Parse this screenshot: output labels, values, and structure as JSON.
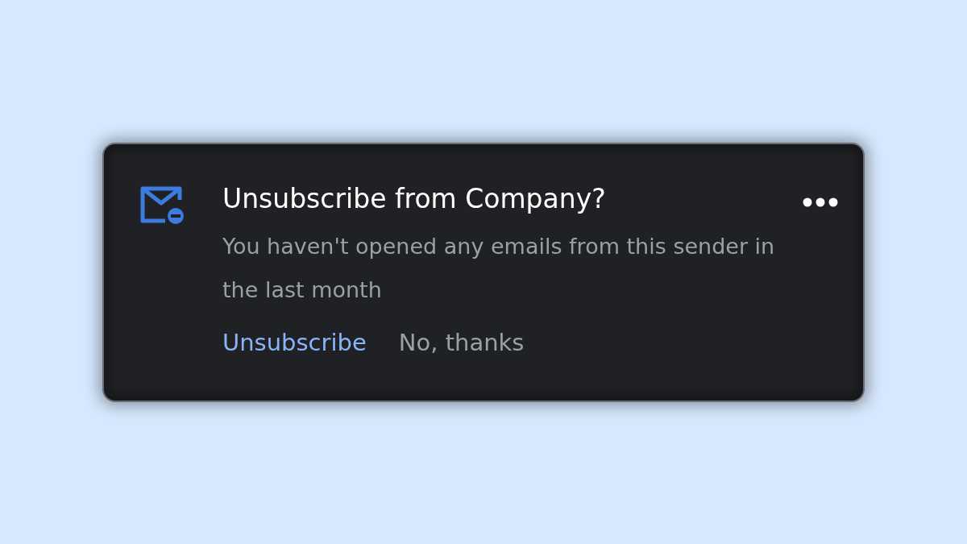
{
  "dialog": {
    "title": "Unsubscribe from Company?",
    "message": "You haven't opened any emails from this sender in the last month",
    "actions": [
      {
        "label": "Unsubscribe",
        "kind": "primary"
      },
      {
        "label": "No, thanks",
        "kind": "secondary"
      }
    ]
  }
}
